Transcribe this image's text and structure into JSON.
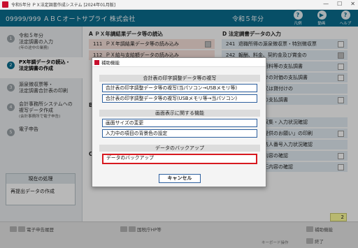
{
  "window": {
    "title": "令和5年分 ＰＸ法定調書作成システム [2024年01月版]",
    "controls": [
      "—",
      "☐",
      "✕"
    ]
  },
  "header": {
    "company": "09999/999 ＡＢＣオートサプライ 株式会社",
    "era": "令和５年分",
    "icons": [
      {
        "name": "guide-icon",
        "glyph": "?",
        "label": "凡例"
      },
      {
        "name": "video-icon",
        "glyph": "▶",
        "label": "動画"
      },
      {
        "name": "help-icon",
        "glyph": "?",
        "label": "ヘルプ"
      }
    ]
  },
  "steps": [
    {
      "num": "1",
      "label": "令和５年分",
      "label2": "法定調書の入力",
      "sub": "(年の途中の業務)",
      "active": false
    },
    {
      "num": "2",
      "label": "PX年調データの読込・",
      "label2": "法定調書の作成",
      "sub": "",
      "active": true
    },
    {
      "num": "3",
      "label": "源泉徴収票等・",
      "label2": "法定調書合計表の印刷",
      "sub": "",
      "active": false
    },
    {
      "num": "4",
      "label": "会計事務所システムへの",
      "label2": "複写データ作成",
      "sub": "(会計事務所で電子申告)",
      "active": false
    },
    {
      "num": "5",
      "label": "電子申告",
      "label2": "",
      "sub": "",
      "active": false
    }
  ],
  "status": {
    "heading": "現在の処理",
    "value": "再提出データの作成"
  },
  "sectionA": {
    "title": "A ＰＸ年調結果データ等の読込",
    "rows": [
      {
        "code": "111",
        "label": "ＰＸ年調結果データ等の読み込み",
        "checked": true
      },
      {
        "code": "112",
        "label": "ＰＸ給与支給額データの読み込み",
        "checked": false
      }
    ]
  },
  "sectionB": {
    "title": "B"
  },
  "sectionC": {
    "title": "C"
  },
  "sectionD": {
    "title": "D 法定調書データの入力",
    "rows": [
      {
        "code": "241",
        "label": "退職所得の源泉徴収票・特別徴収票",
        "checked": false
      },
      {
        "code": "242",
        "label": "報酬、料金、契約金及び賞金の",
        "checked": true
      },
      {
        "code": "",
        "label": "の使用料等の支払調書",
        "checked": false
      },
      {
        "code": "",
        "label": "譲受けの対価の支払調書",
        "checked": false
      },
      {
        "code": "",
        "label": "売買又は貸付けの",
        "checked": false
      },
      {
        "code": "",
        "label": "数料の支払調書",
        "checked": false
      },
      {
        "code": "",
        "label": "番号収集・入力状況確認",
        "checked": false
      },
      {
        "code": "",
        "label": "パー提供のお願い」の印刷",
        "checked": false
      },
      {
        "code": "",
        "label": "人・法人番号入力状況確認",
        "checked": false
      },
      {
        "code": "",
        "label": "修正内容の確認",
        "checked": false
      },
      {
        "code": "",
        "label": "の修正内容の確認",
        "checked": false
      }
    ]
  },
  "pageNumber": "2",
  "bottomBar": {
    "buttons": [
      "電子申告履歴",
      "国税庁HP等",
      "補助機能",
      "終了"
    ],
    "keyboardLabel": "キーボード操作"
  },
  "dialog": {
    "title": "補助機能",
    "groups": [
      {
        "heading": "合計表の印字調整データ等の複写",
        "buttons": [
          "合計表の印字調整データ等の複写(当パソコン→USBメモリ等)",
          "合計表の印字調整データ等の複写(USBメモリ等→当パソコン)"
        ]
      },
      {
        "heading": "画面表示に関する機能",
        "buttons": [
          "画面サイズの変更",
          "入力中の項目の背景色の設定"
        ]
      },
      {
        "heading": "データのバックアップ",
        "buttons": [
          "データのバックアップ"
        ]
      }
    ],
    "cancel": "キャンセル"
  }
}
